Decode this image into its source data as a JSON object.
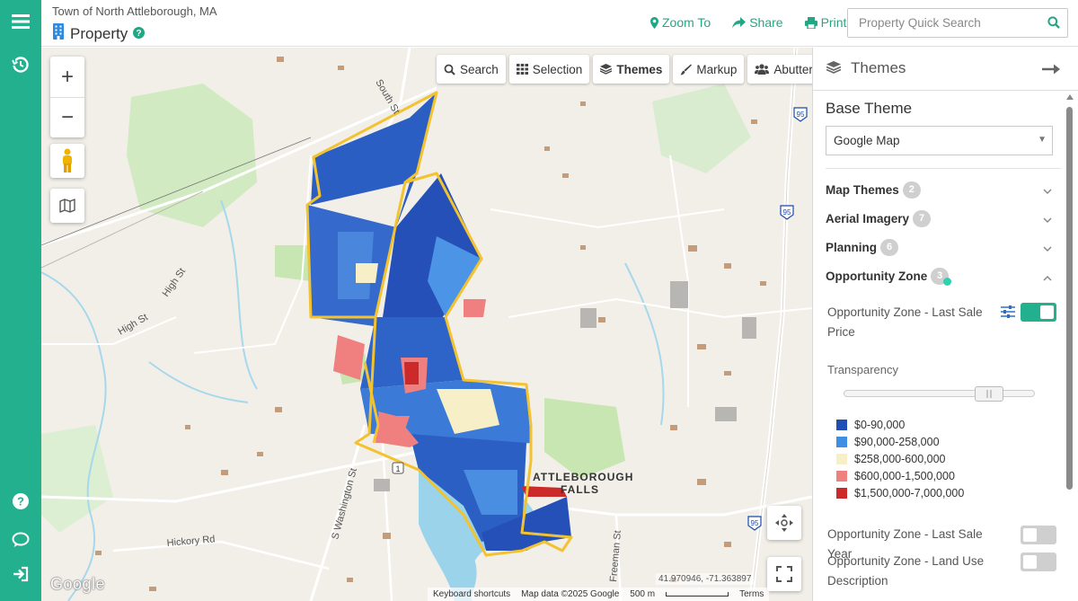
{
  "app": {
    "org": "Town of North Attleborough, MA",
    "page_title": "Property"
  },
  "topbar": {
    "zoom_to": "Zoom To",
    "share": "Share",
    "print": "Print",
    "search_placeholder": "Property Quick Search"
  },
  "sidebar": {
    "icons": [
      "menu-icon",
      "history-icon",
      "help-icon",
      "feedback-icon",
      "login-icon"
    ]
  },
  "map": {
    "tools": {
      "search": "Search",
      "selection": "Selection",
      "themes": "Themes",
      "markup": "Markup",
      "abutters": "Abutters"
    },
    "zoom_in": "+",
    "zoom_out": "−",
    "coords": "41.970946, -71.363897",
    "logo": "Google",
    "attribution": {
      "shortcuts": "Keyboard shortcuts",
      "data": "Map data ©2025 Google",
      "scale": "500 m",
      "terms": "Terms"
    },
    "labels": {
      "south_st": "South St",
      "high_st": "High St",
      "high_st2": "High St",
      "s_washington": "S Washington St",
      "hickory": "Hickory Rd",
      "freeman": "Freeman St",
      "attleborough": "ATTLEBOROUGH",
      "falls": "FALLS",
      "i95_a": "95",
      "i95_b": "95",
      "i95_c": "95",
      "rt1": "1"
    }
  },
  "themes_panel": {
    "title": "Themes",
    "base_theme_label": "Base Theme",
    "base_theme_value": "Google Map",
    "sections": [
      {
        "label": "Map Themes",
        "count": "2"
      },
      {
        "label": "Aerial Imagery",
        "count": "7"
      },
      {
        "label": "Planning",
        "count": "6"
      },
      {
        "label": "Opportunity Zone",
        "count": "3"
      }
    ],
    "layers": {
      "last_sale_price": "Opportunity Zone - Last Sale Price",
      "last_sale_year": "Opportunity Zone - Last Sale Year",
      "land_use": "Opportunity Zone - Land Use Description"
    },
    "transparency_label": "Transparency",
    "transparency_value": 0.8,
    "legend": [
      {
        "label": "$0-90,000",
        "color": "#1f4fb5"
      },
      {
        "label": "$90,000-258,000",
        "color": "#3d8fe4"
      },
      {
        "label": "$258,000-600,000",
        "color": "#f6efc8"
      },
      {
        "label": "$600,000-1,500,000",
        "color": "#f08080"
      },
      {
        "label": "$1,500,000-7,000,000",
        "color": "#cc2a2a"
      }
    ]
  },
  "colors": {
    "accent": "#22b08f",
    "boundary": "#f2c230",
    "water": "#9ad3ea",
    "park": "#c8e6b2"
  }
}
